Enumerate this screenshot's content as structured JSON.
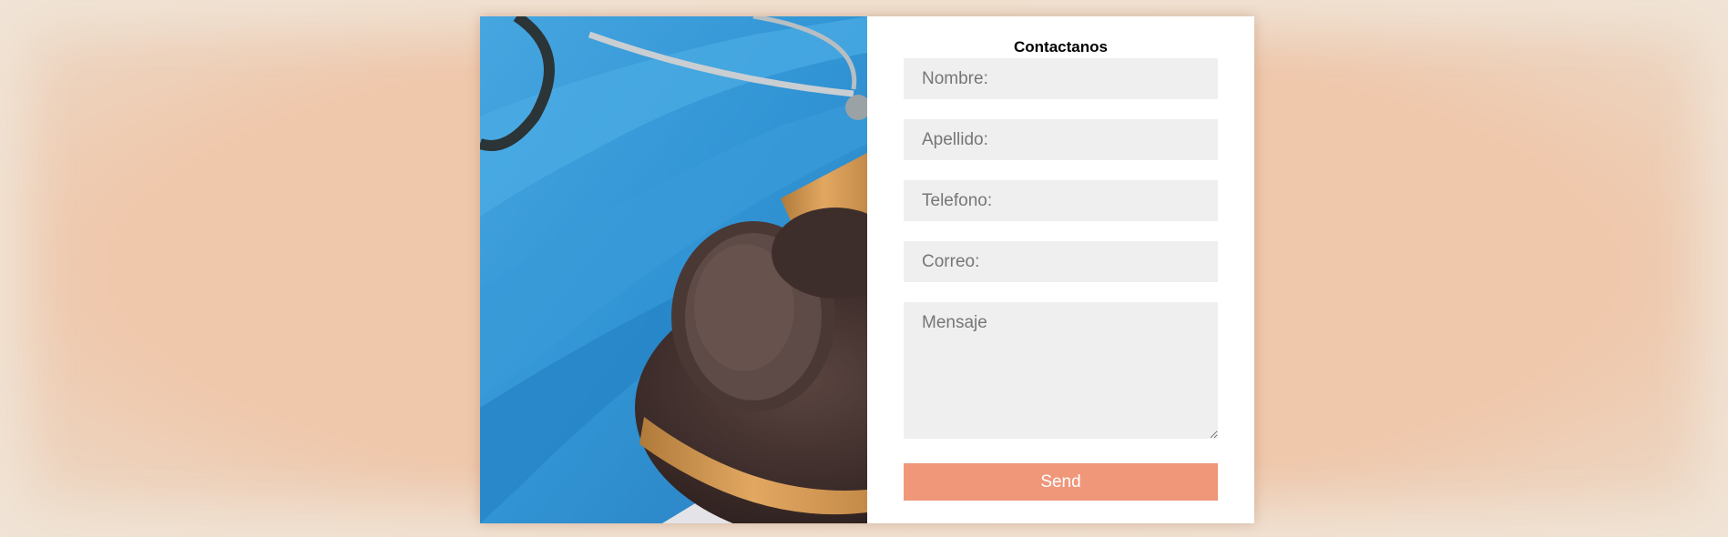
{
  "contact": {
    "title": "Contactanos",
    "fields": {
      "nombre": {
        "placeholder": "Nombre:",
        "value": ""
      },
      "apellido": {
        "placeholder": "Apellido:",
        "value": ""
      },
      "telefono": {
        "placeholder": "Telefono:",
        "value": ""
      },
      "correo": {
        "placeholder": "Correo:",
        "value": ""
      },
      "mensaje": {
        "placeholder": "Mensaje",
        "value": ""
      }
    },
    "send_label": "Send"
  },
  "image": {
    "subject": "stethoscope-and-gavel-photo"
  },
  "colors": {
    "page_background": "#efc7ab",
    "card_background": "#ffffff",
    "field_background": "#efefef",
    "button_background": "#f0977a",
    "button_text": "#ffffff"
  }
}
